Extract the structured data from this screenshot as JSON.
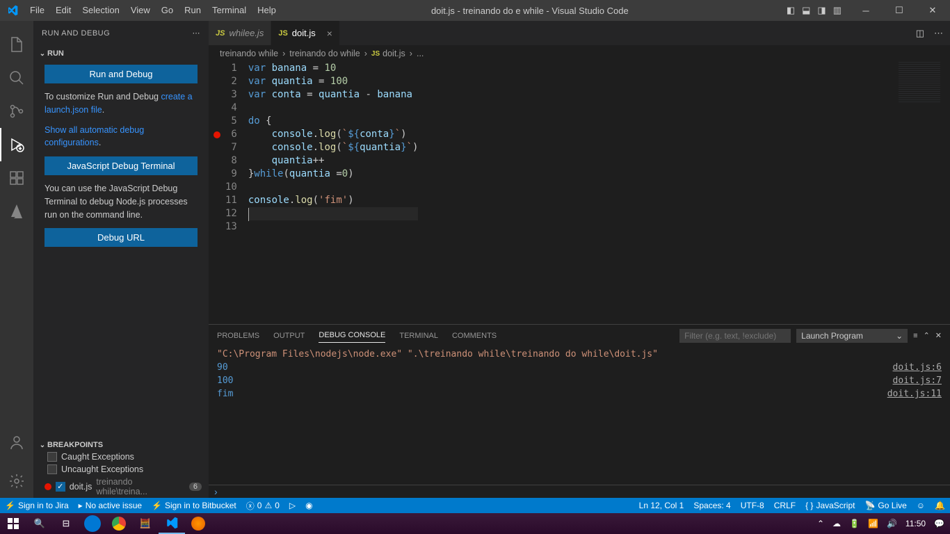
{
  "titlebar": {
    "menus": [
      "File",
      "Edit",
      "Selection",
      "View",
      "Go",
      "Run",
      "Terminal",
      "Help"
    ],
    "title": "doit.js - treinando do e while - Visual Studio Code"
  },
  "sidebar": {
    "header": "RUN AND DEBUG",
    "run_section": "RUN",
    "run_debug_btn": "Run and Debug",
    "customize_pre": "To customize Run and Debug ",
    "customize_link": "create a launch.json file",
    "show_auto_link": "Show all automatic debug configurations",
    "js_terminal_btn": "JavaScript Debug Terminal",
    "js_terminal_hint": "You can use the JavaScript Debug Terminal to debug Node.js processes run on the command line.",
    "debug_url_btn": "Debug URL",
    "breakpoints_title": "BREAKPOINTS",
    "caught": "Caught Exceptions",
    "uncaught": "Uncaught Exceptions",
    "bp_file": "doit.js",
    "bp_path": "treinando while\\treina...",
    "bp_line": "6"
  },
  "tabs": {
    "inactive": "whilee.js",
    "active": "doit.js"
  },
  "breadcrumb": {
    "a": "treinando while",
    "b": "treinando do while",
    "c": "doit.js",
    "d": "..."
  },
  "code": {
    "lines": [
      "1",
      "2",
      "3",
      "4",
      "5",
      "6",
      "7",
      "8",
      "9",
      "10",
      "11",
      "12",
      "13"
    ]
  },
  "panel": {
    "tabs": [
      "PROBLEMS",
      "OUTPUT",
      "DEBUG CONSOLE",
      "TERMINAL",
      "COMMENTS"
    ],
    "filter_placeholder": "Filter (e.g. text, !exclude)",
    "launch": "Launch Program",
    "cmd": "\"C:\\Program Files\\nodejs\\node.exe\" \".\\treinando while\\treinando do while\\doit.js\"",
    "out": [
      {
        "v": "90",
        "s": "doit.js:6"
      },
      {
        "v": "100",
        "s": "doit.js:7"
      },
      {
        "v": "fim",
        "s": "doit.js:11"
      }
    ]
  },
  "status": {
    "jira": "Sign in to Jira",
    "issue": "No active issue",
    "bitbucket": "Sign in to Bitbucket",
    "err": "0",
    "warn": "0",
    "lncol": "Ln 12, Col 1",
    "spaces": "Spaces: 4",
    "enc": "UTF-8",
    "eol": "CRLF",
    "lang": "JavaScript",
    "golive": "Go Live"
  },
  "taskbar": {
    "time": "11:50"
  }
}
